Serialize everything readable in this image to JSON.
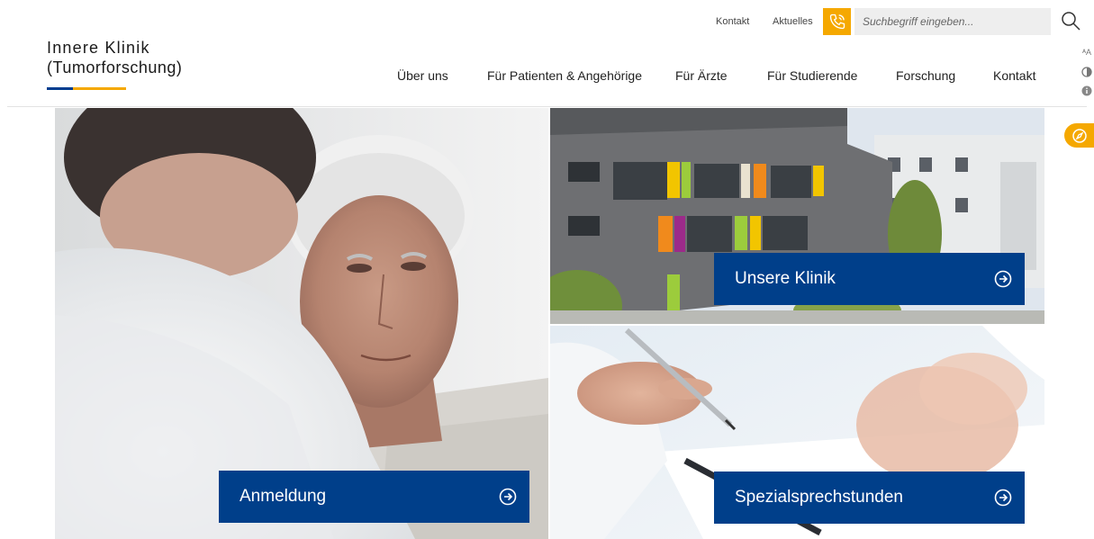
{
  "utility": {
    "kontakt": "Kontakt",
    "aktuelles": "Aktuelles",
    "search_placeholder": "Suchbegriff eingeben..."
  },
  "logo": {
    "line1": "Innere Klinik",
    "line2": "(Tumorforschung)"
  },
  "nav": {
    "items": [
      {
        "label": "Über uns"
      },
      {
        "label": "Für Patienten & Angehörige"
      },
      {
        "label": "Für Ärzte"
      },
      {
        "label": "Für Studierende"
      },
      {
        "label": "Forschung"
      },
      {
        "label": "Kontakt"
      }
    ]
  },
  "tools": {
    "font_size_glyph": "ᴬA"
  },
  "tiles": {
    "anmeldung": "Anmeldung",
    "klinik": "Unsere Klinik",
    "sprechstunden": "Spezialsprechstunden"
  },
  "colors": {
    "brand_blue": "#003f8a",
    "accent_yellow": "#f5a800"
  },
  "icons": [
    "phone-icon",
    "search-icon",
    "font-size-icon",
    "contrast-icon",
    "info-icon",
    "compass-icon",
    "arrow-circle-right-icon"
  ]
}
